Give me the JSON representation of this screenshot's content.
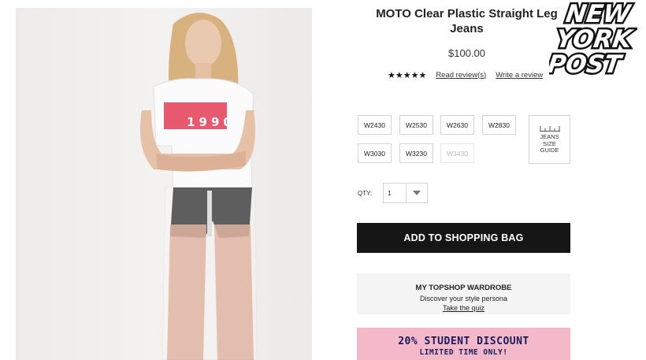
{
  "product": {
    "title": "MOTO Clear Plastic Straight Leg Jeans",
    "price": "$100.00",
    "rating_stars": "★★★★★",
    "rating_value": 4.5,
    "read_reviews": "Read review(s)",
    "write_review": "Write a review"
  },
  "photo": {
    "tee_text": "1990"
  },
  "sizes": [
    {
      "label": "W2430",
      "available": true
    },
    {
      "label": "W2530",
      "available": true
    },
    {
      "label": "W2630",
      "available": true
    },
    {
      "label": "W2830",
      "available": true
    },
    {
      "label": "W3030",
      "available": true
    },
    {
      "label": "W3230",
      "available": true
    },
    {
      "label": "W3430",
      "available": false
    }
  ],
  "size_guide": {
    "line1": "JEANS",
    "line2": "SIZE",
    "line3": "GUIDE"
  },
  "quantity": {
    "label": "QTY:",
    "value": "1"
  },
  "add_to_bag": {
    "label": "ADD TO SHOPPING BAG"
  },
  "wardrobe": {
    "title": "MY TOPSHOP WARDROBE",
    "subtitle": "Discover your style persona",
    "link": "Take the quiz"
  },
  "promo": {
    "main": "20% STUDENT DISCOUNT",
    "sub": "LIMITED TIME ONLY!"
  },
  "watermark": {
    "line1": "NEW",
    "line2": "YORK",
    "line3": "POST"
  },
  "colors": {
    "button_bg": "#161616",
    "promo_bg": "#f3b9c9",
    "promo_text": "#1a1a5e",
    "tee_print": "#e8586f"
  }
}
